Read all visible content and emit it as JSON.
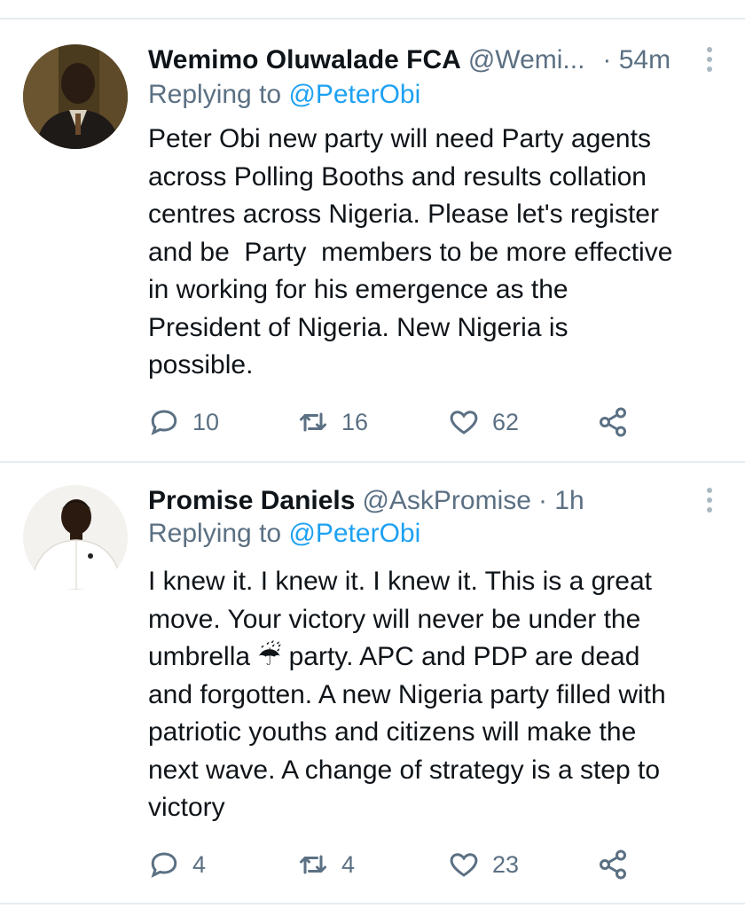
{
  "colors": {
    "muted": "#5b7083",
    "link": "#1da1f2",
    "text": "#0f1419",
    "divider": "#e6ecf0"
  },
  "tweets": [
    {
      "name": "Wemimo Oluwalade FCA",
      "handle": "@Wemi...",
      "time": "· 54m",
      "reply_prefix": "Replying to ",
      "reply_to": "@PeterObi",
      "text": "Peter Obi new party will need Party agents\nacross Polling Booths and results collation\ncentres across Nigeria. Please let's register\nand be  Party  members to be more effective\nin working for his emergence as the\nPresident of Nigeria. New Nigeria is\npossible.",
      "replies": "10",
      "retweets": "16",
      "likes": "62"
    },
    {
      "name": "Promise Daniels",
      "handle": "@AskPromise",
      "time": "· 1h",
      "reply_prefix": "Replying to ",
      "reply_to": "@PeterObi",
      "text": "I knew it. I knew it. I knew it. This is a great\nmove. Your victory will never be under the\numbrella ☔ party. APC and PDP are dead\nand forgotten. A new Nigeria party filled with\npatriotic youths and citizens will make the\nnext wave. A change of strategy is a step to\nvictory",
      "replies": "4",
      "retweets": "4",
      "likes": "23"
    }
  ]
}
